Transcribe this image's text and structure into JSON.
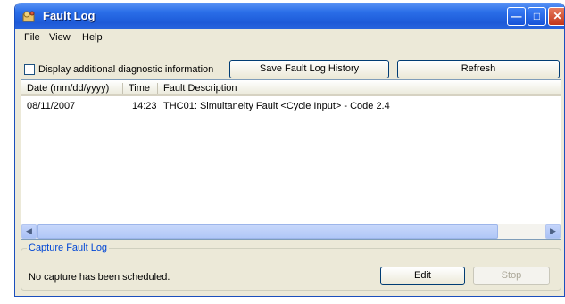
{
  "window": {
    "title": "Fault Log"
  },
  "menu": {
    "items": [
      "File",
      "View",
      "Help"
    ]
  },
  "options": {
    "checkbox_label": "Display additional diagnostic information",
    "checked": false,
    "save_button": "Save Fault Log History",
    "refresh_button": "Refresh"
  },
  "table": {
    "columns": [
      "Date (mm/dd/yyyy)",
      "Time",
      "Fault Description"
    ],
    "rows": [
      {
        "date": "08/11/2007",
        "time": "14:23",
        "description": "THC01: Simultaneity Fault <Cycle Input> - Code 2.4"
      }
    ]
  },
  "capture": {
    "title": "Capture Fault Log",
    "status": "No capture has been scheduled.",
    "edit_button": "Edit",
    "stop_button": "Stop",
    "stop_enabled": false
  },
  "colors": {
    "titlebar": "#2a6ee8",
    "window_bg": "#ECE9D8",
    "group_title": "#0046d5",
    "close_button": "#c2361a"
  }
}
